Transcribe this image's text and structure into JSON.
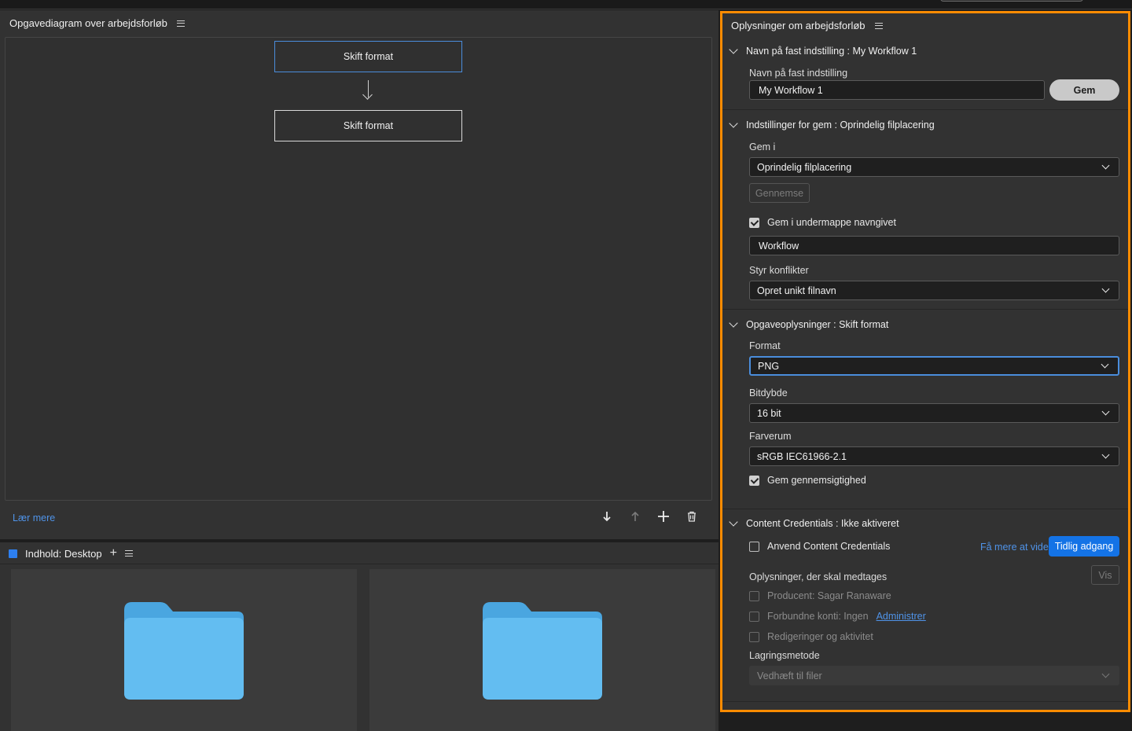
{
  "diagram_panel": {
    "title": "Opgavediagram over arbejdsforløb",
    "tasks": [
      "Skift format",
      "Skift format"
    ],
    "learn_more": "Lær mere"
  },
  "content_panel": {
    "title": "Indhold: Desktop",
    "add_label": "+"
  },
  "info_panel": {
    "title": "Oplysninger om arbejdsforløb",
    "preset_section": {
      "title": "Navn på fast indstilling : My Workflow 1",
      "label": "Navn på fast indstilling",
      "value": "My Workflow 1",
      "save_button": "Gem"
    },
    "save_section": {
      "title": "Indstillinger for gem : Oprindelig filplacering",
      "save_in_label": "Gem i",
      "save_in_value": "Oprindelig filplacering",
      "browse_button": "Gennemse",
      "subfolder_label": "Gem i undermappe navngivet",
      "subfolder_checked": true,
      "subfolder_value": "Workflow",
      "conflicts_label": "Styr konflikter",
      "conflicts_value": "Opret unikt filnavn"
    },
    "task_section": {
      "title": "Opgaveoplysninger : Skift format",
      "format_label": "Format",
      "format_value": "PNG",
      "bitdepth_label": "Bitdybde",
      "bitdepth_value": "16 bit",
      "colorspace_label": "Farverum",
      "colorspace_value": "sRGB IEC61966-2.1",
      "transparency_label": "Gem gennemsigtighed",
      "transparency_checked": true
    },
    "credentials_section": {
      "title": "Content Credentials : Ikke aktiveret",
      "apply_label": "Anvend Content Credentials",
      "apply_checked": false,
      "learn_more_link": "Få mere at vide",
      "early_access_button": "Tidlig adgang",
      "include_label": "Oplysninger, der skal medtages",
      "view_button": "Vis",
      "producer_label": "Producent: Sagar Ranaware",
      "accounts_label": "Forbundne konti: Ingen",
      "manage_link": "Administrer",
      "edits_label": "Redigeringer og aktivitet",
      "storage_label": "Lagringsmetode",
      "storage_value": "Vedhæft til filer"
    }
  },
  "colors": {
    "accent_blue": "#1473e6",
    "highlight_orange": "#ff8c00",
    "folder_blue": "#5ab8ee"
  }
}
